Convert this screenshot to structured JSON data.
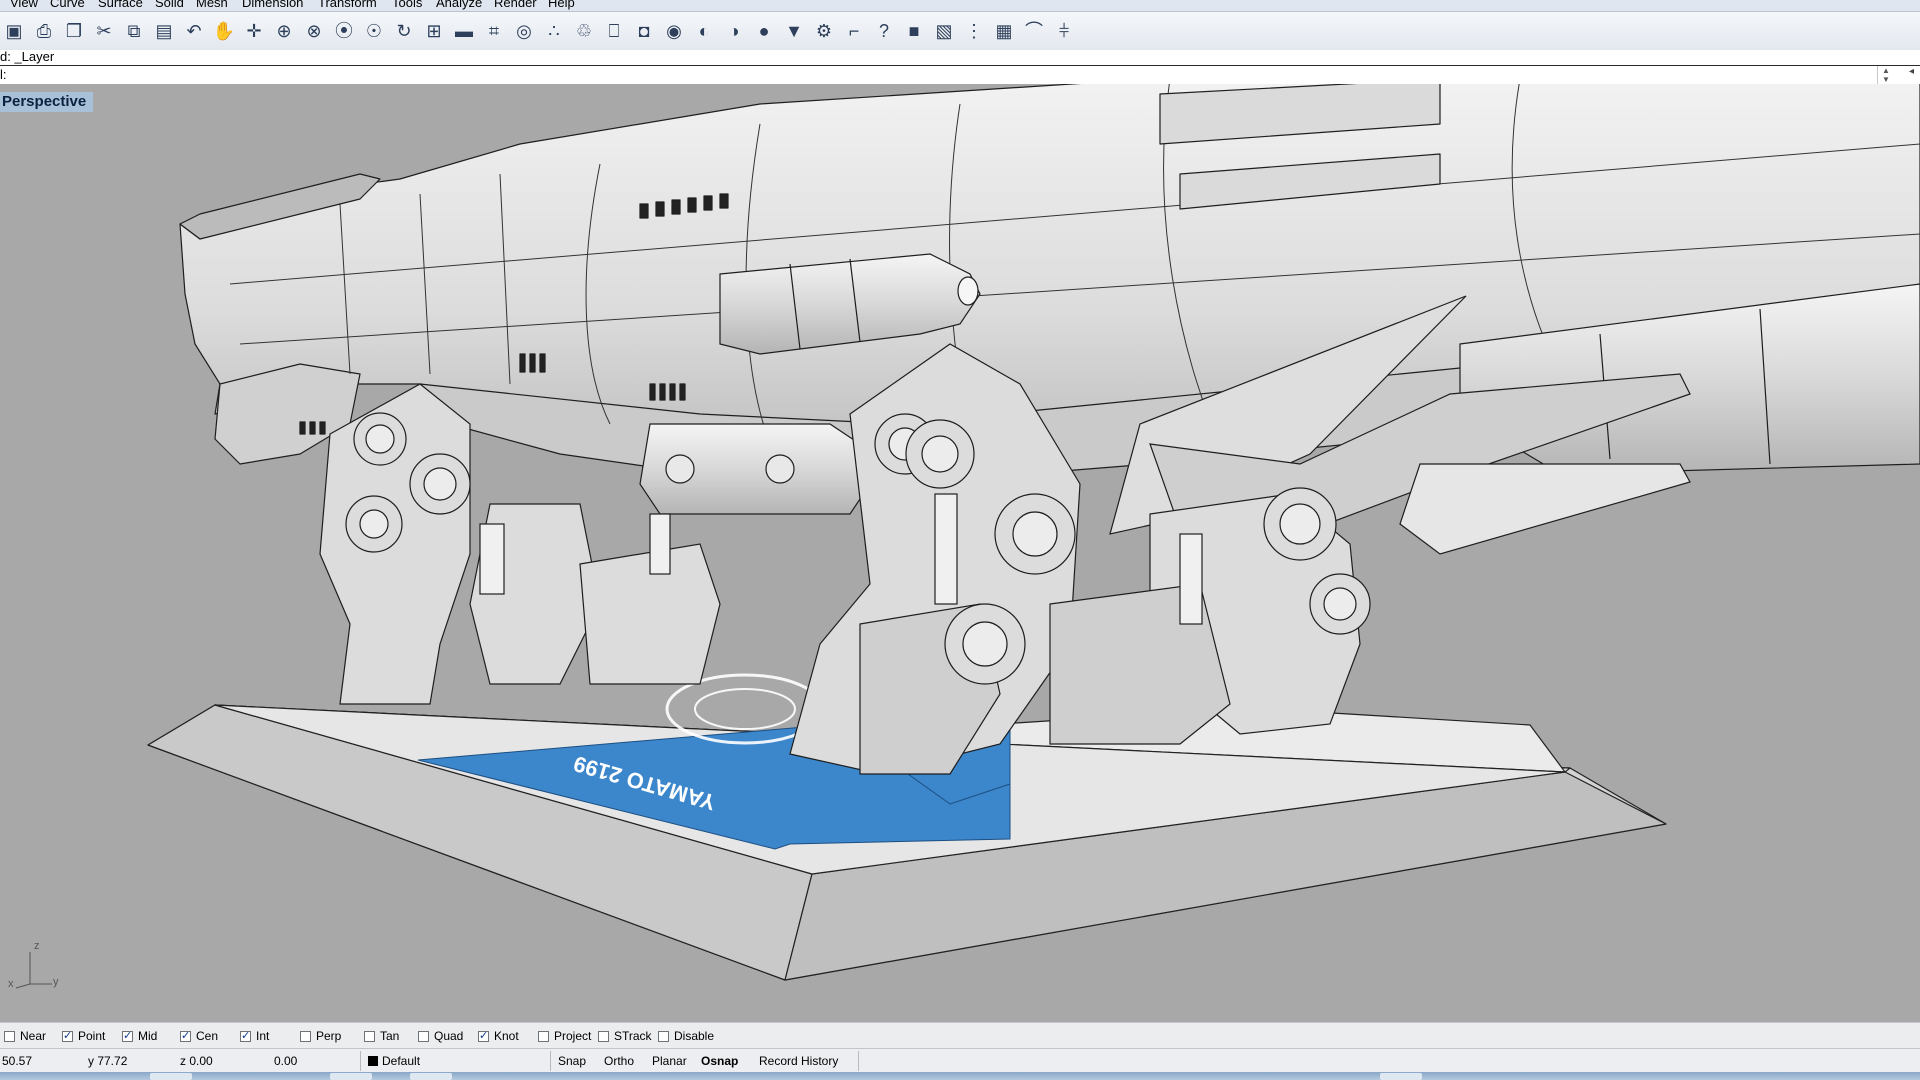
{
  "menu": [
    "View",
    "Curve",
    "Surface",
    "Solid",
    "Mesh",
    "Dimension",
    "Transform",
    "Tools",
    "Analyze",
    "Render",
    "Help"
  ],
  "toolbar_icons": [
    {
      "name": "save-icon",
      "glyph": "▣"
    },
    {
      "name": "print-icon",
      "glyph": "⎙"
    },
    {
      "name": "copy-doc-icon",
      "glyph": "❐"
    },
    {
      "name": "cut-icon",
      "glyph": "✂"
    },
    {
      "name": "copy-icon",
      "glyph": "⧉"
    },
    {
      "name": "paste-icon",
      "glyph": "▤"
    },
    {
      "name": "undo-icon",
      "glyph": "↶"
    },
    {
      "name": "pan-hand-icon",
      "glyph": "✋"
    },
    {
      "name": "move-icon",
      "glyph": "✛"
    },
    {
      "name": "zoom-icon",
      "glyph": "⊕"
    },
    {
      "name": "zoom-window-icon",
      "glyph": "⊗"
    },
    {
      "name": "zoom-extents-icon",
      "glyph": "⦿"
    },
    {
      "name": "zoom-selected-icon",
      "glyph": "☉"
    },
    {
      "name": "rotate-view-icon",
      "glyph": "↻"
    },
    {
      "name": "four-viewports-icon",
      "glyph": "⊞"
    },
    {
      "name": "car-icon",
      "glyph": "▬"
    },
    {
      "name": "mesh-icon",
      "glyph": "⌗"
    },
    {
      "name": "circle-target-icon",
      "glyph": "◎"
    },
    {
      "name": "points-icon",
      "glyph": "∴"
    },
    {
      "name": "light-bulb-icon",
      "glyph": "♲"
    },
    {
      "name": "lock-icon",
      "glyph": "⎕"
    },
    {
      "name": "shield-icon",
      "glyph": "◘"
    },
    {
      "name": "color-wheel-icon",
      "glyph": "◉"
    },
    {
      "name": "sphere-wire-icon",
      "glyph": "◐"
    },
    {
      "name": "sphere-mesh-icon",
      "glyph": "◑"
    },
    {
      "name": "sphere-render-icon",
      "glyph": "●"
    },
    {
      "name": "spotlight-icon",
      "glyph": "▼"
    },
    {
      "name": "gear-icon",
      "glyph": "⚙"
    },
    {
      "name": "dimension-icon",
      "glyph": "⌐"
    },
    {
      "name": "help-icon",
      "glyph": "?"
    },
    {
      "name": "box-view-icon",
      "glyph": "■"
    },
    {
      "name": "cplane-icon",
      "glyph": "▧"
    },
    {
      "name": "vertical-dots-icon",
      "glyph": "⋮"
    },
    {
      "name": "layer-tool-icon",
      "glyph": "▦"
    },
    {
      "name": "rainbow-icon",
      "glyph": "⌒"
    },
    {
      "name": "mirror-icon",
      "glyph": "⫩"
    }
  ],
  "command": {
    "history": "d: _Layer",
    "prompt": "l:"
  },
  "viewport": {
    "title": "Perspective",
    "decal_text": "YAMATO 2199",
    "axis_x": "x",
    "axis_y": "y",
    "axis_z": "z"
  },
  "osnap": [
    {
      "label": "Near",
      "checked": false
    },
    {
      "label": "Point",
      "checked": true
    },
    {
      "label": "Mid",
      "checked": true
    },
    {
      "label": "Cen",
      "checked": true
    },
    {
      "label": "Int",
      "checked": true
    },
    {
      "label": "Perp",
      "checked": false
    },
    {
      "label": "Tan",
      "checked": false
    },
    {
      "label": "Quad",
      "checked": false
    },
    {
      "label": "Knot",
      "checked": true
    },
    {
      "label": "Project",
      "checked": false
    },
    {
      "label": "STrack",
      "checked": false
    },
    {
      "label": "Disable",
      "checked": false
    }
  ],
  "status": {
    "x": "50.57",
    "y": "y 77.72",
    "z": "z 0.00",
    "extra": "0.00",
    "layer": "Default",
    "snap": "Snap",
    "ortho": "Ortho",
    "planar": "Planar",
    "osnap": "Osnap",
    "record_history": "Record History"
  },
  "colors": {
    "viewport_bg": "#a8a8a8",
    "model_fill": "#e4e4e4",
    "decal_blue": "#3c86cc",
    "viewport_title_bg": "#a9c0d9"
  }
}
